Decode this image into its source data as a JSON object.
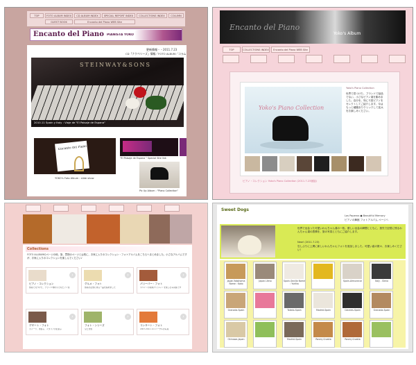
{
  "top_left": {
    "nav": [
      "TOP",
      "FOTO ALBUM INDEX",
      "CD ALBUM INDEX",
      "SPECIAL REPORT INDEX",
      "COLLECTIONS INDEX",
      "COLUMN",
      "GUEST BOOK",
      "Encanto del Piano WEB Site"
    ],
    "banner_title": "Encanto del Piano",
    "banner_subtitle": "PIANISTA YOKO TAKAKI",
    "update_label": "更新情報・・2011.7.23",
    "update_text": "CD「ナクベリーズ」情報／FOTO ALBUM／コラム",
    "hero_brand": "STEINWAY&SONS",
    "hero_caption": "2010.11 Spain y Italy : Viaje de \"El Paisaje de Espana\"",
    "thumb1_caption": "YOKO's Foto Album : slide show",
    "thumb2_caption": "\"El Paisaje de Espana \" Special Site link",
    "thumb3_caption": "Pic Up Album : \"Piano Collection\"",
    "thumb1_card_title": "Encanto del Piano"
  },
  "top_right": {
    "banner_title": "Encanto del Piano",
    "banner_subtitle": "Yoko's Album",
    "nav": [
      "TOP",
      "COLLECTIONS INDEX",
      "Encanto del Piano WEB Site"
    ],
    "showcase_title": "Yoko's Piano Collection",
    "side_title": "Yoko's Piano Collection",
    "side_text": "世界で見つけた、ブランドで製品でない、小さなピアノ達を集めました。自分を、特にモ型ピアノをセレクトしてご紹介します。今はもっと種類ありクリックして拡大をお楽しみください。",
    "link_text": "ピアノ・コレクション  Yoko's Piano Collection (2011.7.23追加)"
  },
  "bottom_left": {
    "section_title": "Collections",
    "intro_text": "FOTO ALLBUMのページの他、旅、買物のページとは別に、お気に入りのコレクション・フォトアルバムをこちらへまとめました。小さなアルバムですが、お気に入りのコレクションを楽しんでください♪",
    "cards": [
      {
        "label": "ピアノ・コレクション",
        "desc": "旅先で見つけた、ブランド物の小さなピアノ達"
      },
      {
        "label": "グルメ・フォト",
        "desc": "旅先の記憶に残る一品を集めました"
      },
      {
        "label": "パリーバー・フォト",
        "desc": "スペインの先端パリジャン を楽しむ写真集です"
      },
      {
        "label": "デザート・フォト",
        "desc": "スイーツ、洋菓子、イタリアのお菓子"
      },
      {
        "label": "フォト・シリーズ",
        "desc": "空と景色"
      },
      {
        "label": "コンサート・フォト",
        "desc": "2007-2011 ユニバーサルの写真"
      }
    ]
  },
  "bottom_right": {
    "title": "Sweet Dogs",
    "links": [
      "Los Paperos",
      "Beautiful Memory",
      "ピアノの舞館",
      "フォトアルバム",
      "ページへ"
    ],
    "intro": "世界で出会った可愛いわんちゃん達の一枚。優しい出会の瞬間とともに、旅先で記憶に残るわんちゃん達の表情を、旅の写真とともにご紹介します。",
    "news_label": "New! (2011.7.23)",
    "news_text": "忘しぶりに上掲に新しいわんちゃんフォトを追加しました。可愛い姿の数々、お楽しみください！",
    "dogs": [
      {
        "cap": "Japan-Yokohama Name : Koko"
      },
      {
        "cap": "Japan-Ueno"
      },
      {
        "cap": "Spain-Sevilla Name : Yuritta"
      },
      {
        "cap": ""
      },
      {
        "cap": "Spain-Almunecar"
      },
      {
        "cap": "Italy - Siena"
      },
      {
        "cap": "Granada-Spain"
      },
      {
        "cap": ""
      },
      {
        "cap": "Toledo-Spain"
      },
      {
        "cap": "Madrid-Spain"
      },
      {
        "cap": "Cáceres-Spain"
      },
      {
        "cap": "Granada-Spain"
      },
      {
        "cap": "Okinawa-Japan"
      },
      {
        "cap": ""
      },
      {
        "cap": "Madrid-Spain"
      },
      {
        "cap": "Rovinj-Croatia"
      },
      {
        "cap": "Rovinj-Croatia"
      },
      {
        "cap": ""
      }
    ]
  },
  "colors": {
    "mauve": "#c8a5a0",
    "pink": "#f6d4da",
    "purple": "#7a2a78",
    "lime": "#d9ea55"
  }
}
